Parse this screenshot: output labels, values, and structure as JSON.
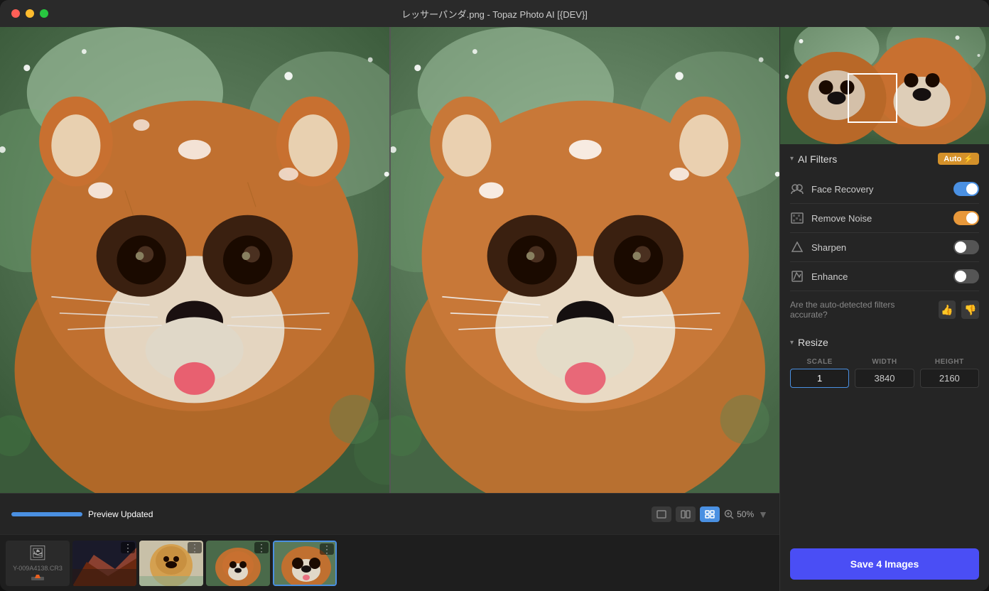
{
  "window": {
    "title": "レッサーパンダ.png - Topaz Photo AI [{DEV}]"
  },
  "toolbar": {
    "preview_text": "Preview Updated"
  },
  "view_controls": {
    "zoom_label": "50%",
    "views": [
      "single",
      "split-h",
      "split-v"
    ]
  },
  "right_panel": {
    "ai_filters": {
      "section_title": "AI Filters",
      "auto_badge": "Auto",
      "filters": [
        {
          "name": "Face Recovery",
          "icon": "👥",
          "state": "on-blue"
        },
        {
          "name": "Remove Noise",
          "icon": "🔲",
          "state": "on-orange"
        },
        {
          "name": "Sharpen",
          "icon": "▲",
          "state": "off"
        },
        {
          "name": "Enhance",
          "icon": "📐",
          "state": "off"
        }
      ],
      "accuracy_question": "Are the auto-detected filters accurate?"
    },
    "resize": {
      "section_title": "Resize",
      "scale_label": "SCALE",
      "width_label": "WIDTH",
      "height_label": "HEIGHT",
      "scale_value": "1",
      "width_value": "3840",
      "height_value": "2160"
    },
    "save_button": "Save 4 Images"
  },
  "filmstrip": {
    "items": [
      {
        "type": "placeholder",
        "filename": "Y-009A4138.CR3"
      },
      {
        "type": "thumbnail",
        "color": "#5a3a2a"
      },
      {
        "type": "thumbnail",
        "color": "#c8b89a"
      },
      {
        "type": "thumbnail",
        "color": "#8a7a5a"
      },
      {
        "type": "thumbnail",
        "color": "#c85020",
        "active": true
      }
    ]
  }
}
